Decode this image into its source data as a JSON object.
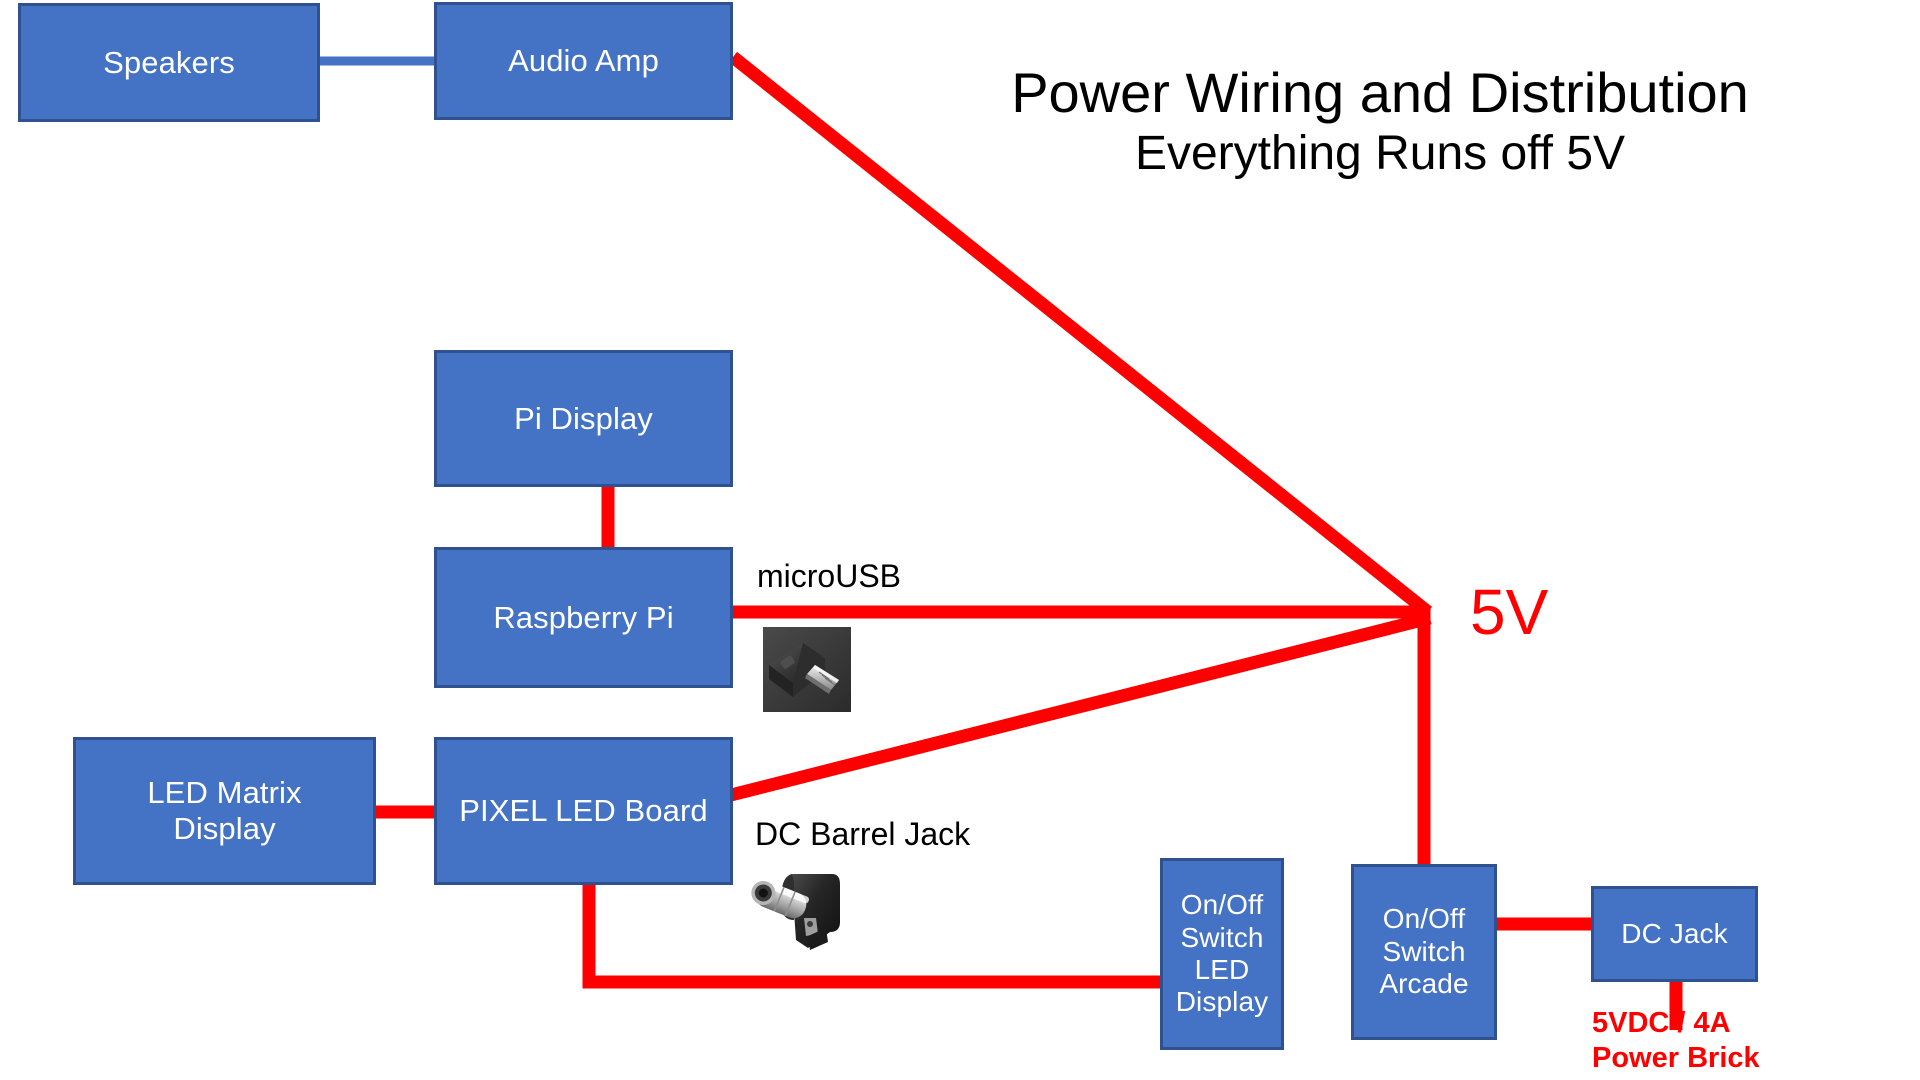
{
  "title": {
    "main": "Power Wiring and Distribution",
    "sub": "Everything Runs off 5V"
  },
  "colors": {
    "box_fill": "#4472C4",
    "box_border": "#2F528F",
    "power_wire": "#FF0000",
    "signal_wire": "#4472C4",
    "text_on_box": "#FFFFFF",
    "label_text": "#000000",
    "background": "#FFFFFF"
  },
  "nodes": [
    {
      "id": "speakers",
      "label": "Speakers"
    },
    {
      "id": "audio_amp",
      "label": "Audio Amp"
    },
    {
      "id": "pi_display",
      "label": "Pi Display"
    },
    {
      "id": "raspberry_pi",
      "label": "Raspberry Pi"
    },
    {
      "id": "led_matrix",
      "label": "LED Matrix\nDisplay"
    },
    {
      "id": "pixel_led_board",
      "label": "PIXEL LED Board"
    },
    {
      "id": "switch_led",
      "label": "On/Off\nSwitch\nLED\nDisplay"
    },
    {
      "id": "switch_arcade",
      "label": "On/Off\nSwitch\nArcade"
    },
    {
      "id": "dc_jack",
      "label": "DC Jack"
    }
  ],
  "labels": {
    "micro_usb": "microUSB",
    "dc_barrel_jack": "DC Barrel Jack",
    "bus_voltage": "5V",
    "power_brick": "5VDC / 4A\nPower Brick"
  },
  "photos": [
    {
      "id": "micro-usb-photo",
      "caption": "microUSB"
    },
    {
      "id": "dc-barrel-jack-photo",
      "caption": "DC Barrel Jack"
    }
  ],
  "connections": [
    {
      "from": "speakers",
      "to": "audio_amp",
      "wire": "signal"
    },
    {
      "from": "pi_display",
      "to": "raspberry_pi",
      "wire": "power"
    },
    {
      "from": "led_matrix",
      "to": "pixel_led_board",
      "wire": "power"
    },
    {
      "from": "audio_amp",
      "to": "bus_5v",
      "wire": "power"
    },
    {
      "from": "raspberry_pi",
      "to": "bus_5v",
      "wire": "power"
    },
    {
      "from": "pixel_led_board",
      "to": "bus_5v",
      "wire": "power"
    },
    {
      "from": "bus_5v",
      "to": "switch_arcade",
      "wire": "power"
    },
    {
      "from": "switch_arcade",
      "to": "dc_jack",
      "wire": "power"
    },
    {
      "from": "dc_jack",
      "to": "power_brick",
      "wire": "power"
    },
    {
      "from": "pixel_led_board",
      "to": "switch_led",
      "wire": "power"
    }
  ]
}
